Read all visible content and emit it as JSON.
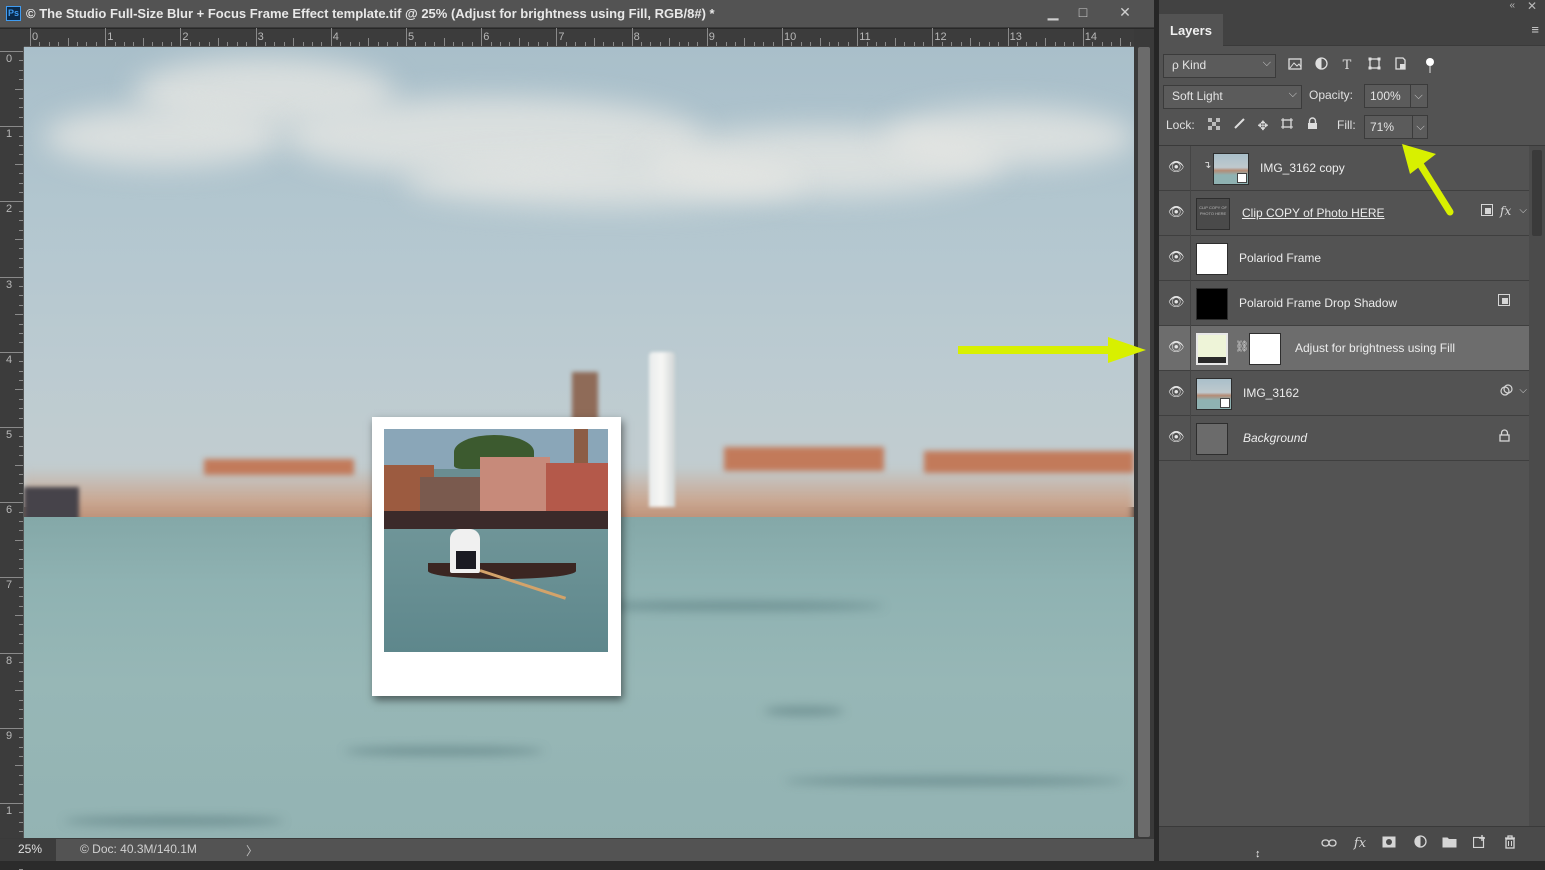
{
  "document": {
    "app_icon": "Ps",
    "title": "© The Studio Full-Size Blur + Focus Frame Effect template.tif @ 25% (Adjust for brightness using Fill, RGB/8#) *",
    "window_buttons": {
      "minimize": "▁",
      "maximize": "□",
      "close": "✕"
    },
    "ruler_top": [
      "0",
      "1",
      "2",
      "3",
      "4",
      "5",
      "6",
      "7",
      "8",
      "9",
      "10",
      "11",
      "12",
      "13",
      "14"
    ],
    "ruler_left": [
      "0",
      "1",
      "2",
      "3",
      "4",
      "5",
      "6",
      "7",
      "8",
      "9",
      "1"
    ],
    "status": {
      "zoom": "25%",
      "doc_info": "© Doc: 40.3M/140.1M",
      "arrow": "〉"
    }
  },
  "layers_panel": {
    "tab": "Layers",
    "menu_icon": "≡",
    "collapse_icon": "«",
    "close_icon": "✕",
    "filter": {
      "label": "ρ Kind",
      "icons": [
        "image-filter-icon",
        "adjustment-filter-icon",
        "type-filter-icon",
        "shape-filter-icon",
        "smart-object-filter-icon",
        "filter-toggle-icon"
      ]
    },
    "blend_mode": "Soft Light",
    "opacity": {
      "label": "Opacity:",
      "value": "100%"
    },
    "lock": {
      "label": "Lock:"
    },
    "fill": {
      "label": "Fill:",
      "value": "71%"
    },
    "layers": [
      {
        "name": "IMG_3162 copy",
        "selected": false
      },
      {
        "name": "Clip COPY of Photo HERE ",
        "selected": false
      },
      {
        "name": "Polariod Frame",
        "selected": false
      },
      {
        "name": "Polaroid Frame Drop Shadow",
        "selected": false
      },
      {
        "name": "Adjust for brightness using Fill",
        "selected": true
      },
      {
        "name": "IMG_3162",
        "selected": false
      },
      {
        "name": "Background",
        "selected": false
      }
    ],
    "thumb_text": "CLIP COPY OF PHOTO HERE",
    "fx_label": "fx",
    "bottom_fx": "fx"
  },
  "colors": {
    "panel_bg": "#535353",
    "selected_row": "#6d6d6d",
    "annotation_arrow": "#d8f000"
  }
}
